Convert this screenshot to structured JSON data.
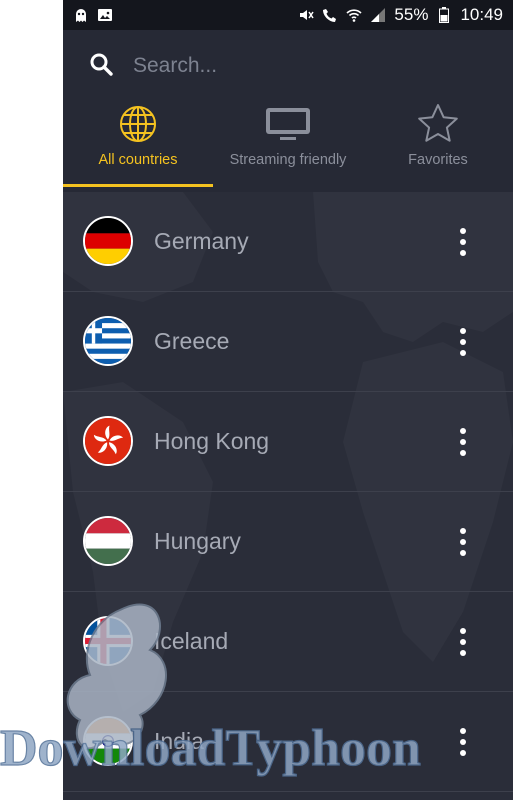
{
  "statusbar": {
    "battery": "55%",
    "time": "10:49"
  },
  "search": {
    "placeholder": "Search..."
  },
  "tabs": [
    {
      "label": "All countries",
      "icon": "globe-icon",
      "active": true
    },
    {
      "label": "Streaming friendly",
      "icon": "tv-icon",
      "active": false
    },
    {
      "label": "Favorites",
      "icon": "star-icon",
      "active": false
    }
  ],
  "countries": [
    {
      "name": "Germany",
      "flag": "germany-flag-icon"
    },
    {
      "name": "Greece",
      "flag": "greece-flag-icon"
    },
    {
      "name": "Hong Kong",
      "flag": "hong-kong-flag-icon"
    },
    {
      "name": "Hungary",
      "flag": "hungary-flag-icon"
    },
    {
      "name": "Iceland",
      "flag": "iceland-flag-icon"
    },
    {
      "name": "India",
      "flag": "india-flag-icon"
    }
  ],
  "watermark": {
    "text": "DownloadTyphoon"
  },
  "colors": {
    "background": "#262935",
    "accent": "#f4c220",
    "text_muted": "#a6aab5",
    "divider": "#3d404c"
  }
}
